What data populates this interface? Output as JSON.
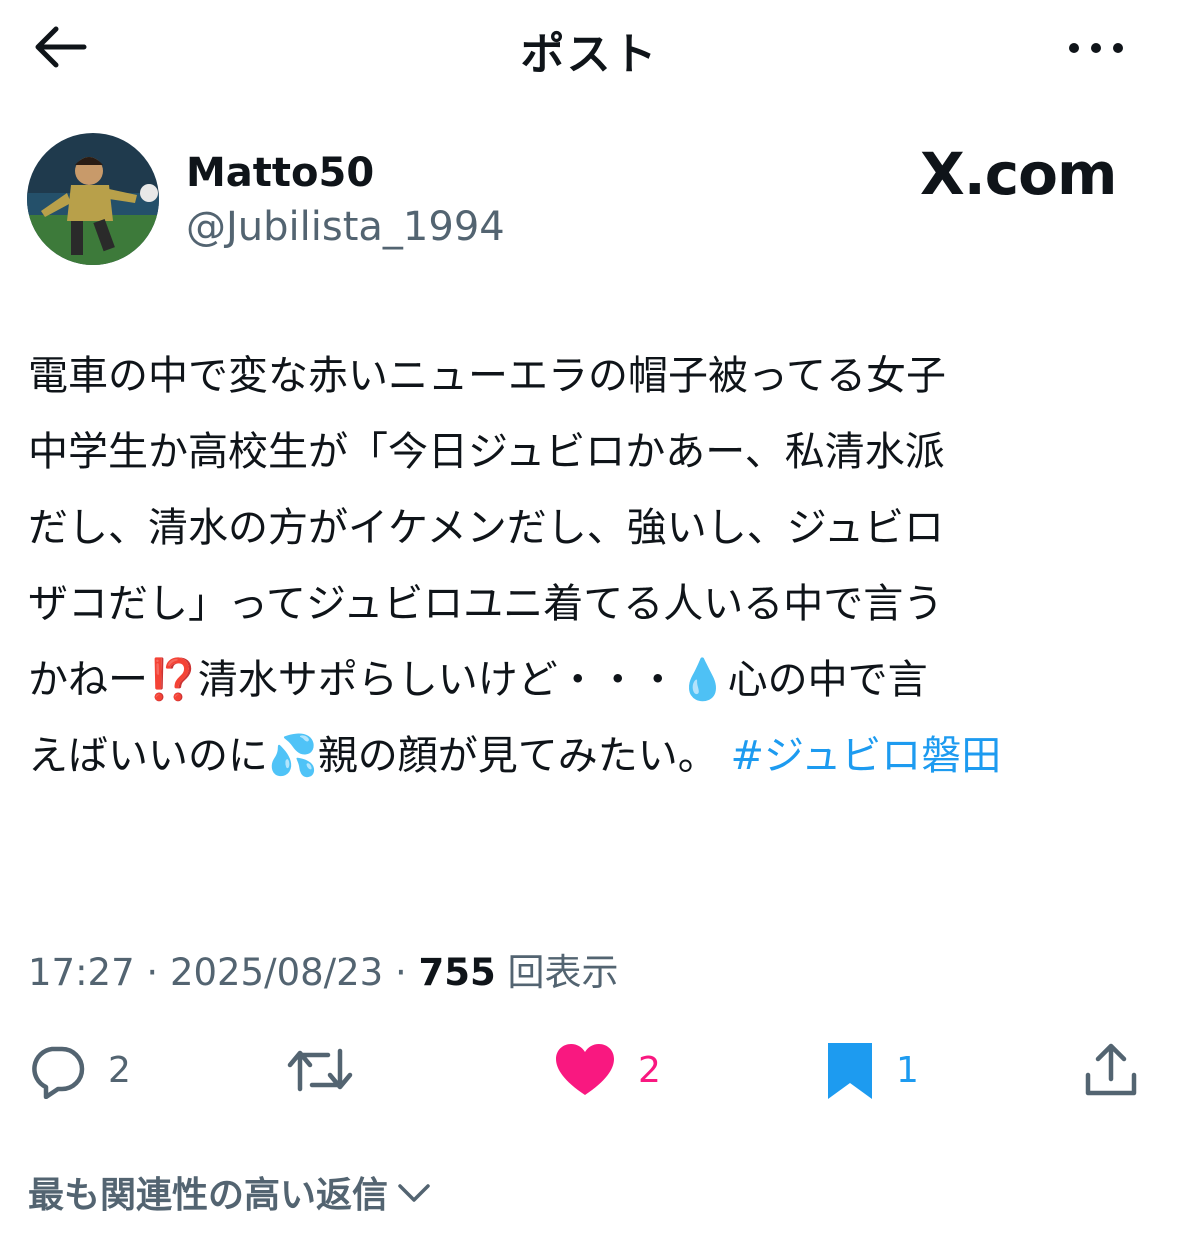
{
  "header": {
    "title": "ポスト",
    "back_icon": "arrow-left-icon",
    "more_icon": "more-dots-icon"
  },
  "author": {
    "display_name": "Matto50",
    "handle": "@Jubilista_1994",
    "avatar_icon": "user-avatar"
  },
  "brand": {
    "logo": "X.com"
  },
  "tweet": {
    "line1": "電車の中で変な赤いニューエラの帽子被ってる女子",
    "line2": "中学生か高校生が「今日ジュビロかあー、私清水派",
    "line3": "だし、清水の方がイケメンだし、強いし、ジュビロ",
    "line4": "ザコだし」ってジュビロユニ着てる人いる中で言う",
    "line5a": "かねー",
    "emoji_exclaim": "⁉️",
    "line5b": "清水サポらしいけど・・・",
    "emoji_drop": "💧",
    "line5c": "心の中で言",
    "line6a": "えばいいのに",
    "emoji_sweat": "💦",
    "line6b": "親の顔が見てみたい。 ",
    "hashtag": "#ジュビロ磐田"
  },
  "meta": {
    "time": "17:27",
    "sep1": " · ",
    "date": "2025/08/23",
    "sep2": " · ",
    "views": "755",
    "views_label": " 回表示"
  },
  "actions": {
    "reply": {
      "icon": "reply-bubble-icon",
      "count": "2"
    },
    "retweet": {
      "icon": "retweet-icon",
      "count": ""
    },
    "like": {
      "icon": "heart-filled-icon",
      "count": "2",
      "color": "#f91880"
    },
    "bookmark": {
      "icon": "bookmark-filled-icon",
      "count": "1",
      "color": "#1d9bf0"
    },
    "share": {
      "icon": "share-icon"
    }
  },
  "replies": {
    "sort_label": "最も関連性の高い返信"
  }
}
